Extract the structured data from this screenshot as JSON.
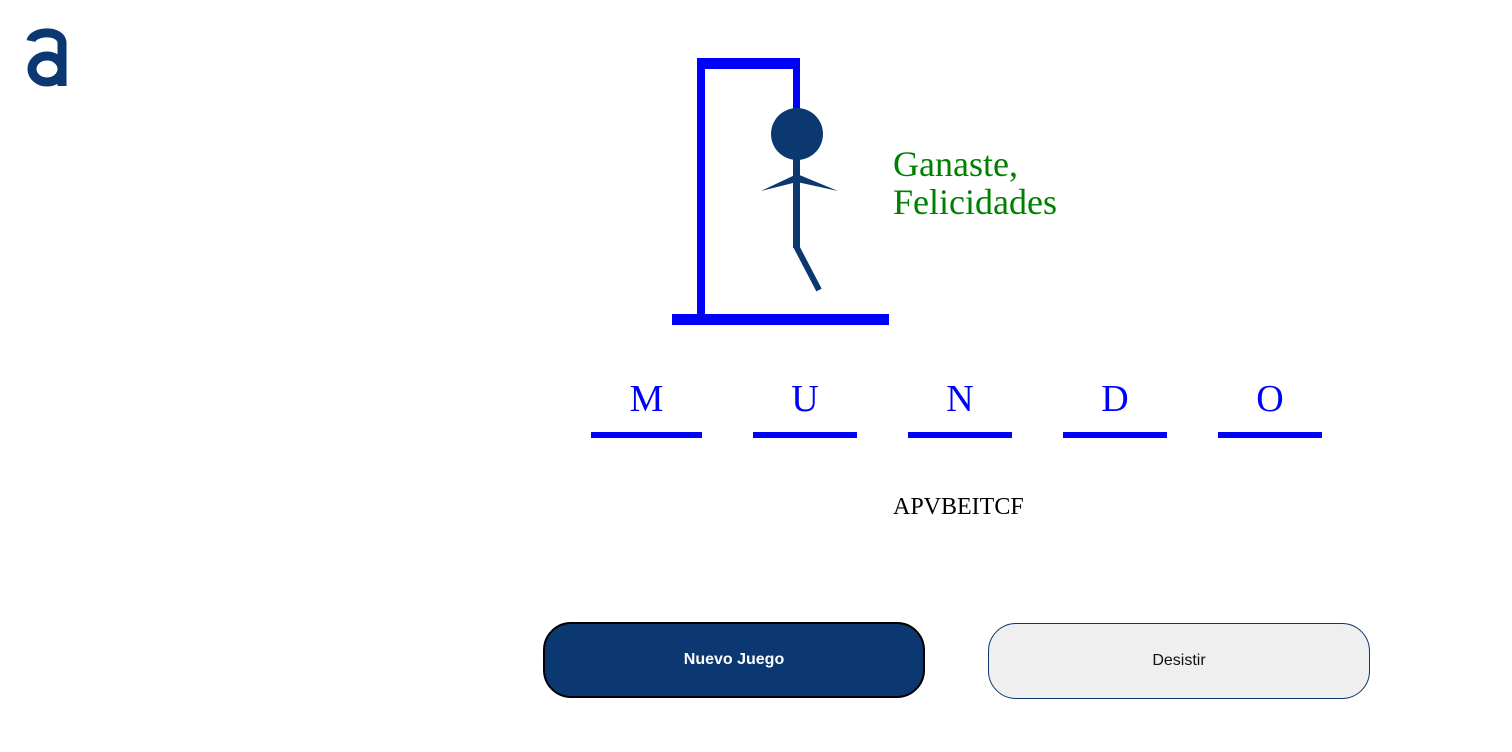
{
  "logo": {
    "icon": "a-logo-icon",
    "color": "#0b3870"
  },
  "game": {
    "status_message_line1": "Ganaste,",
    "status_message_line2": "Felicidades",
    "word_letters": [
      "M",
      "U",
      "N",
      "D",
      "O"
    ],
    "used_letters": "APVBEITCF",
    "errors_shown": 4
  },
  "colors": {
    "gallows": "#0000ff",
    "figure": "#0b3870",
    "message": "#008000",
    "letters": "#0000ff",
    "primary_button": "#0b3870"
  },
  "buttons": {
    "new_game_label": "Nuevo Juego",
    "quit_label": "Desistir"
  }
}
